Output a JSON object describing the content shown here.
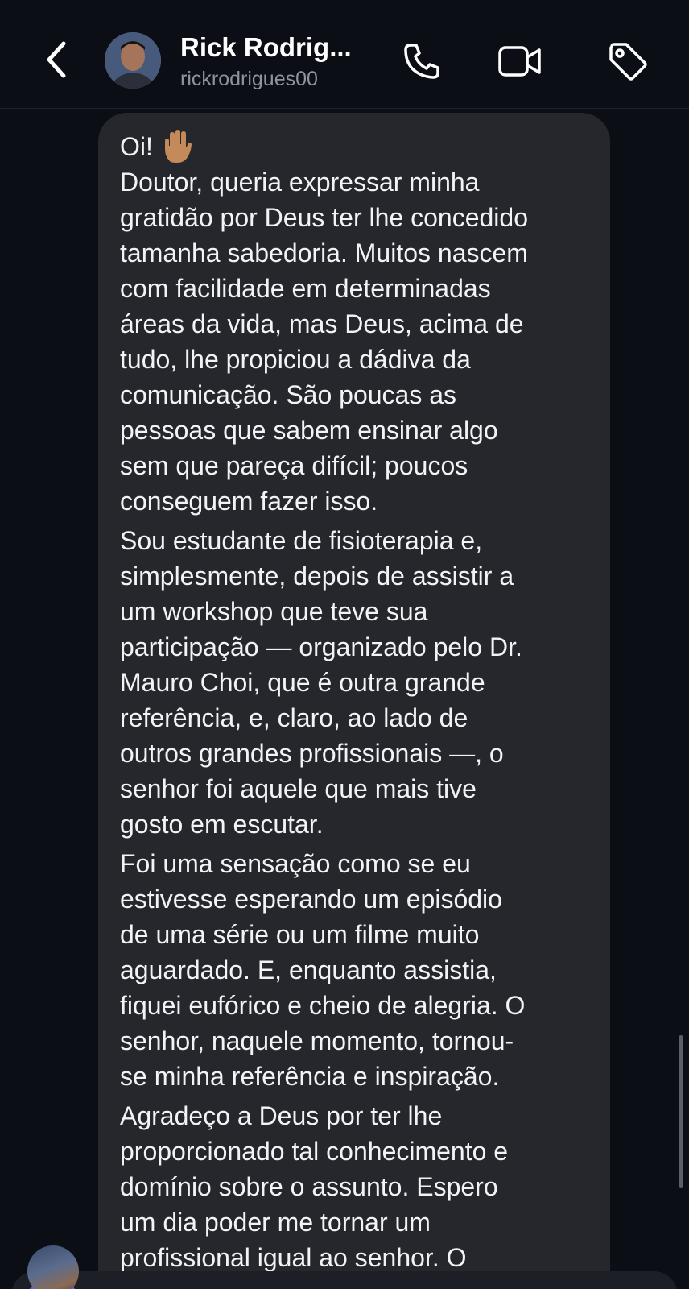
{
  "header": {
    "contact_name": "Rick Rodrig...",
    "contact_handle": "rickrodrigues00",
    "icons": [
      "chevron-left-icon",
      "phone-icon",
      "video-icon",
      "tag-icon"
    ]
  },
  "message": {
    "greeting": "Oi!",
    "emoji": "raised-hand",
    "paragraphs": [
      "Doutor, queria expressar minha\ngratidão por Deus ter lhe concedido\ntamanha sabedoria. Muitos nascem\ncom facilidade em determinadas\náreas da vida, mas Deus, acima de\ntudo, lhe propiciou a dádiva da\ncomunicação. São poucas as\npessoas que sabem ensinar algo\nsem que pareça difícil; poucos\nconseguem fazer isso.",
      "Sou estudante de fisioterapia e,\nsimplesmente, depois de assistir a\num workshop que teve sua\nparticipação — organizado pelo Dr.\nMauro Choi, que é outra grande\nreferência, e, claro, ao lado de\noutros grandes profissionais —, o\nsenhor foi aquele que mais tive\ngosto em escutar.",
      "Foi uma sensação como se eu\nestivesse esperando um episódio\nde uma série ou um filme muito\naguardado. E, enquanto assistia,\nfiquei eufórico e cheio de alegria. O\nsenhor, naquele momento, tornou-\nse minha referência e inspiração.",
      "Agradeço a Deus por ter lhe\nproporcionado tal conhecimento e\ndomínio sobre o assunto. Espero\num dia poder me tornar um\nprofissional igual ao senhor. O"
    ]
  },
  "colors": {
    "background": "#0b0e14",
    "bubble": "#25272d",
    "text": "#f2f3f5",
    "handle": "#8e939c",
    "accent": "#5b5ff5"
  }
}
